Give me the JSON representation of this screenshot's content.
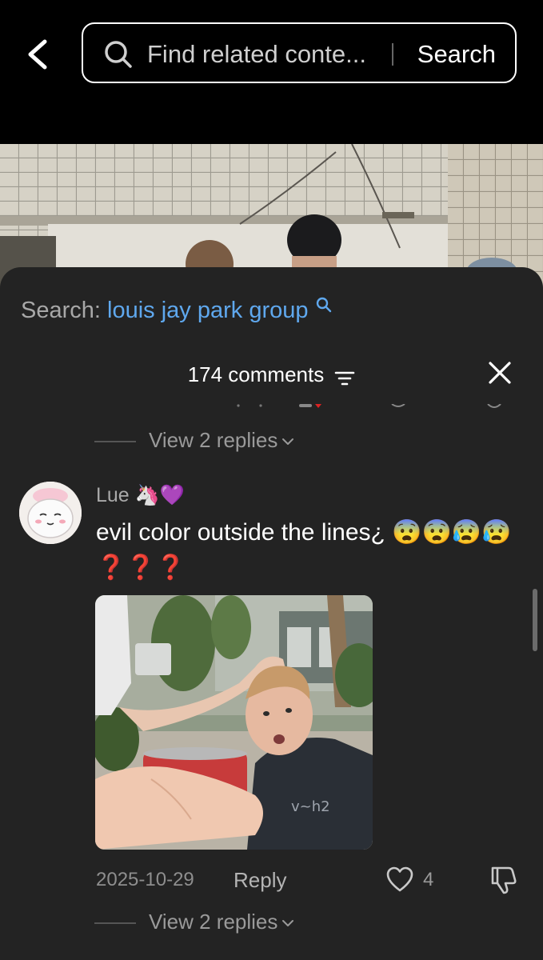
{
  "search": {
    "placeholder": "Find related conte...",
    "button_label": "Search"
  },
  "related": {
    "prefix": "Search:",
    "query": "louis jay park group"
  },
  "comments": {
    "count_label": "174 comments",
    "prev_view_replies": "View 2 replies",
    "items": [
      {
        "username": "Lue 🦄💜",
        "text": "evil color outside the lines¿ 😨😨😰😰❓❓❓",
        "date": "2025-10-29",
        "reply_label": "Reply",
        "likes": "4",
        "view_replies": "View 2 replies"
      }
    ]
  },
  "icons": {
    "back": "chevron-left-icon",
    "search": "search-icon",
    "sort": "sort-lines-icon",
    "close": "close-icon",
    "like": "heart-icon",
    "dislike": "thumbs-down-icon"
  },
  "colors": {
    "sheet_bg": "#232323",
    "link_blue": "#5fa8ee",
    "muted_text": "#a9a9a9"
  }
}
